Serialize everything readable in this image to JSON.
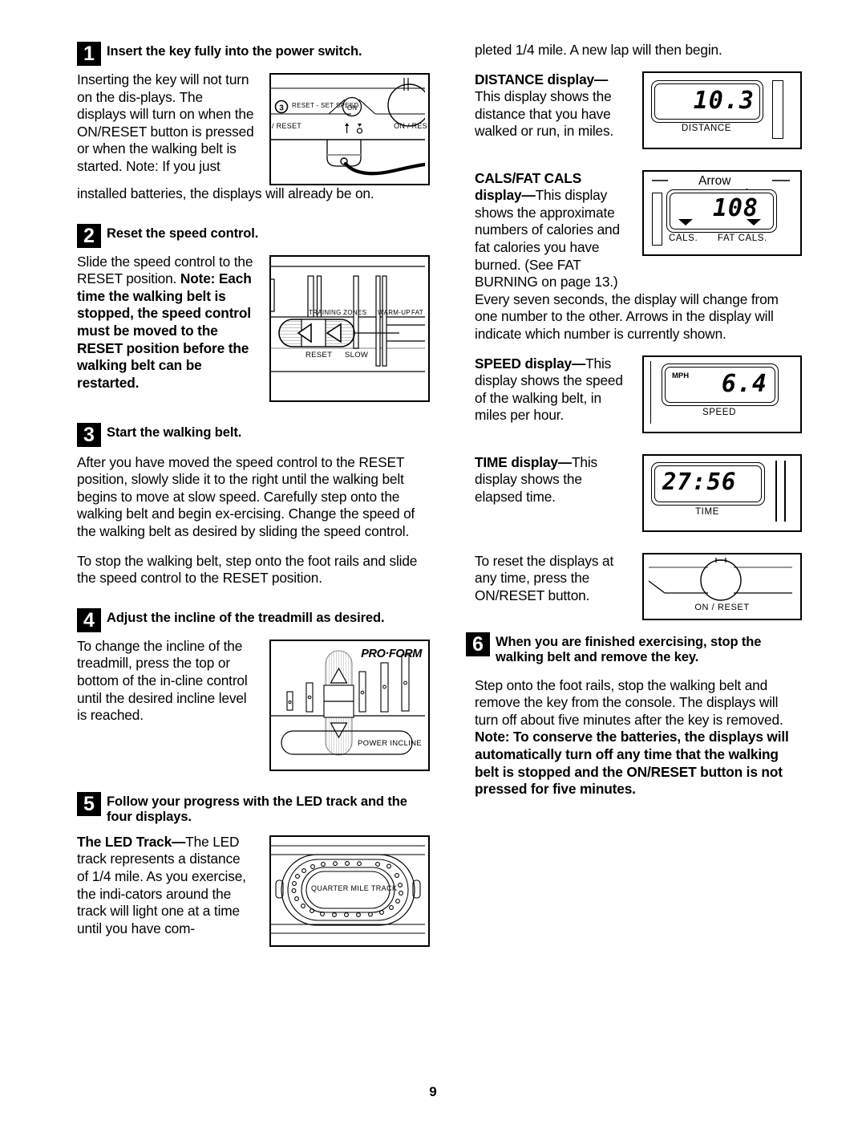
{
  "page_number": "9",
  "left_column": {
    "step1": {
      "number": "1",
      "title": "Insert the key fully into the power switch.",
      "para_narrow": "Inserting the key will not turn on the dis-plays. The displays will turn on when the ON/RESET button is pressed or when the walking belt is started. Note: If you just",
      "para_full": "installed batteries, the displays will already be on.",
      "figure": {
        "name": "power-switch-diagram",
        "label_reset_set_speed": "RESET - SET SPEED",
        "label_circle_number": "3",
        "label_on": "ON",
        "label_reset": "/ RESET",
        "label_on_reset": "ON / RES"
      }
    },
    "step2": {
      "number": "2",
      "title": "Reset the speed control.",
      "para_plain": "Slide the speed control to the RESET position. ",
      "para_bold": "Note: Each time the walking belt is stopped, the speed control must be moved to the RESET position before the walking belt can be restarted.",
      "figure": {
        "name": "speed-control-diagram",
        "label_training_zones": "TRAINING ZONES",
        "label_warm_up": "WARM-UP",
        "label_fat": "FAT",
        "label_reset": "RESET",
        "label_slow": "SLOW"
      }
    },
    "step3": {
      "number": "3",
      "title": "Start the walking belt.",
      "para1": "After you have moved the speed control to the RESET position, slowly slide it to the right until the walking belt begins to move at slow speed. Carefully step onto the walking belt and begin ex-ercising. Change the speed of the walking belt as desired by sliding the speed control.",
      "para2": "To stop the walking belt, step onto the foot rails and slide the speed control to the RESET position."
    },
    "step4": {
      "number": "4",
      "title": "Adjust the incline of the treadmill as desired.",
      "para": "To change the incline of the treadmill, press the top or bottom of the in-cline control until the desired incline level is reached.",
      "figure": {
        "name": "incline-control-diagram",
        "brand": "PRO·FORM",
        "label_power_incline": "POWER INCLINE"
      }
    },
    "step5": {
      "number": "5",
      "title": "Follow your progress with the LED track and the four displays.",
      "para_bold": "The LED Track—",
      "para_rest": "The LED track represents a distance of 1/4 mile. As you exercise, the indi-cators around the track will light one at a time until you have com-",
      "figure": {
        "name": "led-track-diagram",
        "label_quarter_mile_track": "QUARTER MILE TRACK"
      }
    }
  },
  "right_column": {
    "continuation": "pleted 1/4 mile. A new lap will then begin.",
    "distance": {
      "heading_bold": "DISTANCE display—",
      "text": "This display shows the distance that you have walked or run, in miles.",
      "display_value": "10.3",
      "display_label": "DISTANCE"
    },
    "cals": {
      "heading_bold_1": "CALS/FAT CALS",
      "heading_bold_2": "display—",
      "text": "This display shows the approximate numbers of calories and fat calories you have burned. (See FAT BURNING on page 13.)",
      "para_full": "Every seven seconds, the display will change from one number to the other. Arrows in the display will indicate which number is currently shown.",
      "display_value": "108",
      "callout": "Arrow",
      "label_cals": "CALS.",
      "label_fat_cals": "FAT CALS."
    },
    "speed": {
      "heading_bold": "SPEED display—",
      "text": "This display shows the speed of the walking belt, in miles per hour.",
      "display_value": "6.4",
      "display_unit": "MPH",
      "display_label": "SPEED"
    },
    "time": {
      "heading_bold": "TIME display—",
      "text": "This display shows the elapsed time.",
      "display_value": "27:56",
      "display_label": "TIME"
    },
    "reset": {
      "text": "To reset the displays at any time, press the ON/RESET button.",
      "display_label": "ON / RESET"
    },
    "step6": {
      "number": "6",
      "title": "When you are finished exercising, stop the walking belt and remove the key.",
      "para_plain": "Step onto the foot rails, stop the walking belt and remove the key from the console. The displays will turn off about five minutes after the key is removed. ",
      "para_bold": "Note: To conserve the batteries, the displays will automatically turn off any time that the walking belt is stopped and the ON/RESET button is not pressed for five minutes."
    }
  }
}
